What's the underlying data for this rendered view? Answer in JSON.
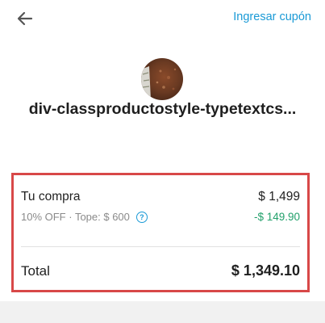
{
  "header": {
    "back_icon": "arrow-left-icon",
    "coupon_link_label": "Ingresar cupón",
    "accent_color": "#1a9ad6"
  },
  "product": {
    "image_icon": "product-thumbnail",
    "title": "div-classproductostyle-typetextcs..."
  },
  "summary": {
    "purchase_label": "Tu compra",
    "purchase_amount": "$ 1,499",
    "discount_label": "10% OFF · Tope: $ 600",
    "discount_help_icon": "question-circle-icon",
    "discount_amount": "-$ 149.90",
    "discount_color": "#22a06b",
    "total_label": "Total",
    "total_amount": "$ 1,349.10",
    "highlight_color": "#d84848"
  }
}
